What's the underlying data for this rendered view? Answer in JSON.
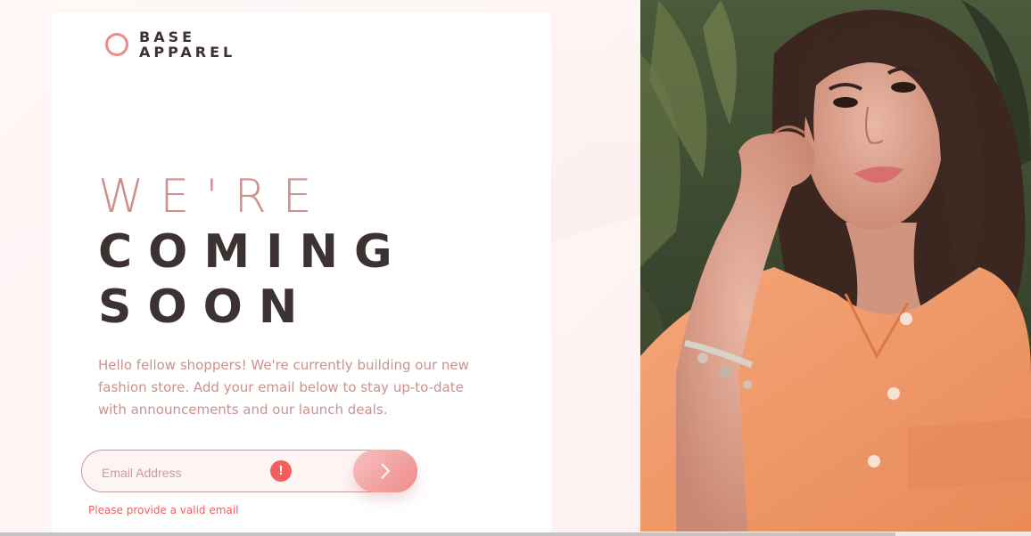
{
  "brand": {
    "line1": "BASE",
    "line2": "APPAREL"
  },
  "hero": {
    "line1": "WE'RE",
    "line2": "COMING",
    "line3": "SOON"
  },
  "description": "Hello fellow shoppers! We're currently building our new fashion store. Add your email below to stay up-to-date with announcements and our launch deals.",
  "form": {
    "email_placeholder": "Email Address",
    "email_value": "",
    "error_icon": "!",
    "error_message": "Please provide a valid email",
    "submit_icon": "chevron-right-icon"
  },
  "colors": {
    "accent": "#ee8c8c",
    "primary_text": "#3d3232",
    "desaturated_red": "#ce9797",
    "error": "#f25f5c"
  },
  "icons": [
    "logo-ring-icon",
    "exclamation-icon",
    "chevron-right-icon"
  ]
}
